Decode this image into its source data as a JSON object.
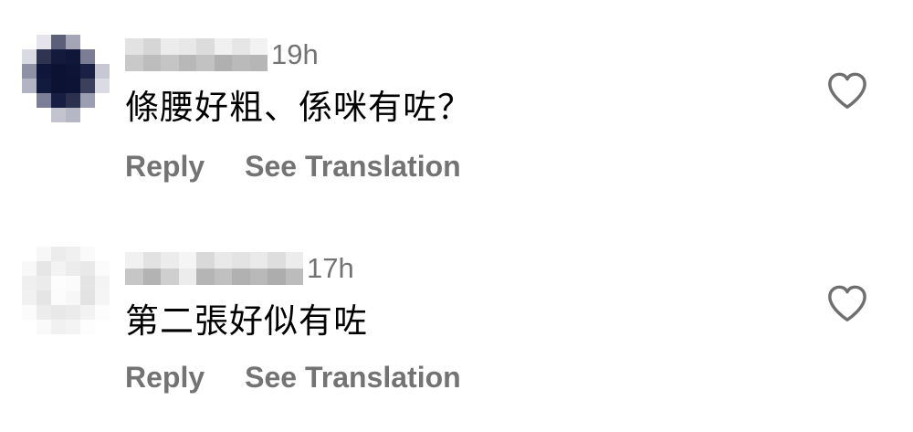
{
  "colors": {
    "background": "#ffffff",
    "text": "#000000",
    "muted": "#737373",
    "icon": "#6f6f6f"
  },
  "comments": [
    {
      "time": "19h",
      "text": "條腰好粗、係咪有咗？",
      "reply_label": "Reply",
      "translate_label": "See Translation",
      "like_icon": "heart-outline-icon"
    },
    {
      "time": "17h",
      "text": "第二張好似有咗",
      "reply_label": "Reply",
      "translate_label": "See Translation",
      "like_icon": "heart-outline-icon"
    }
  ]
}
